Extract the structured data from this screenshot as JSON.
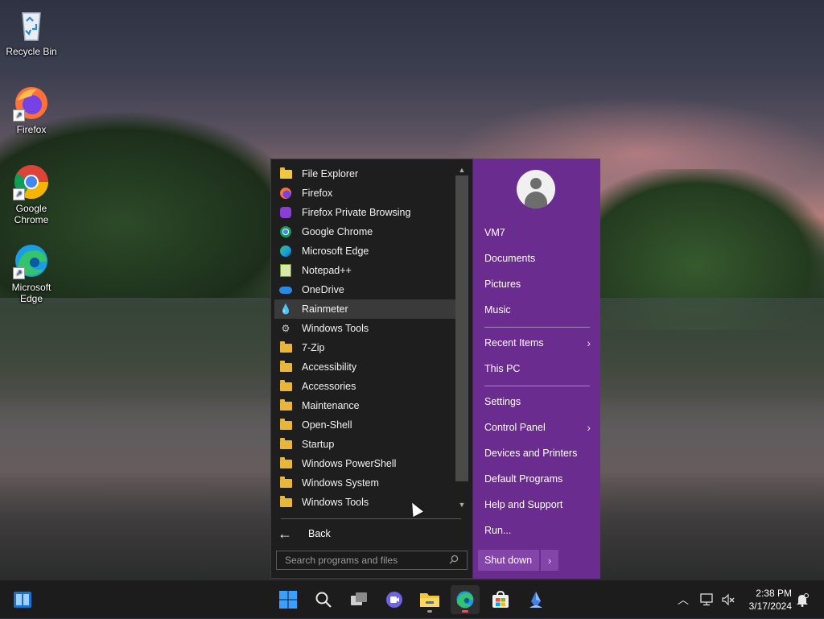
{
  "desktop": {
    "icons": [
      {
        "label": "Recycle Bin"
      },
      {
        "label": "Firefox"
      },
      {
        "label": "Google Chrome"
      },
      {
        "label": "Microsoft Edge"
      }
    ]
  },
  "start_menu": {
    "programs": [
      {
        "label": "File Explorer",
        "icon": "file-explorer-icon"
      },
      {
        "label": "Firefox",
        "icon": "firefox-icon"
      },
      {
        "label": "Firefox Private Browsing",
        "icon": "firefox-private-icon"
      },
      {
        "label": "Google Chrome",
        "icon": "chrome-icon"
      },
      {
        "label": "Microsoft Edge",
        "icon": "edge-icon"
      },
      {
        "label": "Notepad++",
        "icon": "notepadpp-icon"
      },
      {
        "label": "OneDrive",
        "icon": "onedrive-icon"
      },
      {
        "label": "Rainmeter",
        "icon": "rainmeter-icon"
      },
      {
        "label": "Windows Tools",
        "icon": "windows-tools-icon"
      },
      {
        "label": "7-Zip",
        "icon": "folder-icon"
      },
      {
        "label": "Accessibility",
        "icon": "folder-icon"
      },
      {
        "label": "Accessories",
        "icon": "folder-icon"
      },
      {
        "label": "Maintenance",
        "icon": "folder-icon"
      },
      {
        "label": "Open-Shell",
        "icon": "folder-icon"
      },
      {
        "label": "Startup",
        "icon": "folder-icon"
      },
      {
        "label": "Windows PowerShell",
        "icon": "folder-icon"
      },
      {
        "label": "Windows System",
        "icon": "folder-icon"
      },
      {
        "label": "Windows Tools",
        "icon": "folder-icon"
      }
    ],
    "selected_program": "Rainmeter",
    "back_label": "Back",
    "search_placeholder": "Search programs and files",
    "right_items": {
      "user": "VM7",
      "documents": "Documents",
      "pictures": "Pictures",
      "music": "Music",
      "recent_items": "Recent Items",
      "this_pc": "This PC",
      "settings": "Settings",
      "control_panel": "Control Panel",
      "devices_printers": "Devices and Printers",
      "default_programs": "Default Programs",
      "help_support": "Help and Support",
      "run": "Run..."
    },
    "shutdown_label": "Shut down",
    "accent_color": "#6b2c8f"
  },
  "taskbar": {
    "time": "2:38 PM",
    "date": "3/17/2024"
  }
}
